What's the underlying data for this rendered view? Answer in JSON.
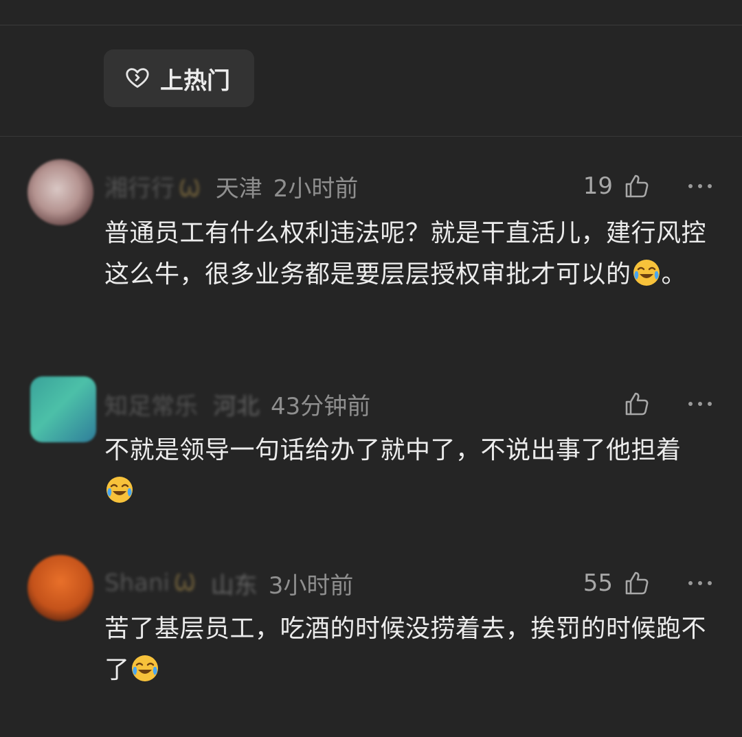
{
  "hot_button": {
    "label": "上热门",
    "icon": "heart-hot-icon"
  },
  "comments": [
    {
      "username": "湘行行",
      "location": "天津",
      "time": "2小时前",
      "likes": "19",
      "text": "普通员工有什么权利违法呢？就是干直活儿，建行风控这么牛，很多业务都是要层层授权审批才可以的",
      "suffix": "。",
      "emoji": "crying-laughing-emoji"
    },
    {
      "username": "知足常乐",
      "location": "河北",
      "time": "43分钟前",
      "likes": "",
      "text": "不就是领导一句话给办了就中了，不说出事了他担着",
      "suffix": "",
      "emoji": "crying-laughing-emoji"
    },
    {
      "username": "Shani",
      "location": "山东",
      "time": "3小时前",
      "likes": "55",
      "text": "苦了基层员工，吃酒的时候没捞着去，挨罚的时候跑不了",
      "suffix": "",
      "emoji": "crying-laughing-emoji"
    }
  ],
  "colors": {
    "background": "#252525",
    "button_bg": "#333333",
    "meta_text": "#8f8f8f",
    "body_text": "#ececec"
  }
}
